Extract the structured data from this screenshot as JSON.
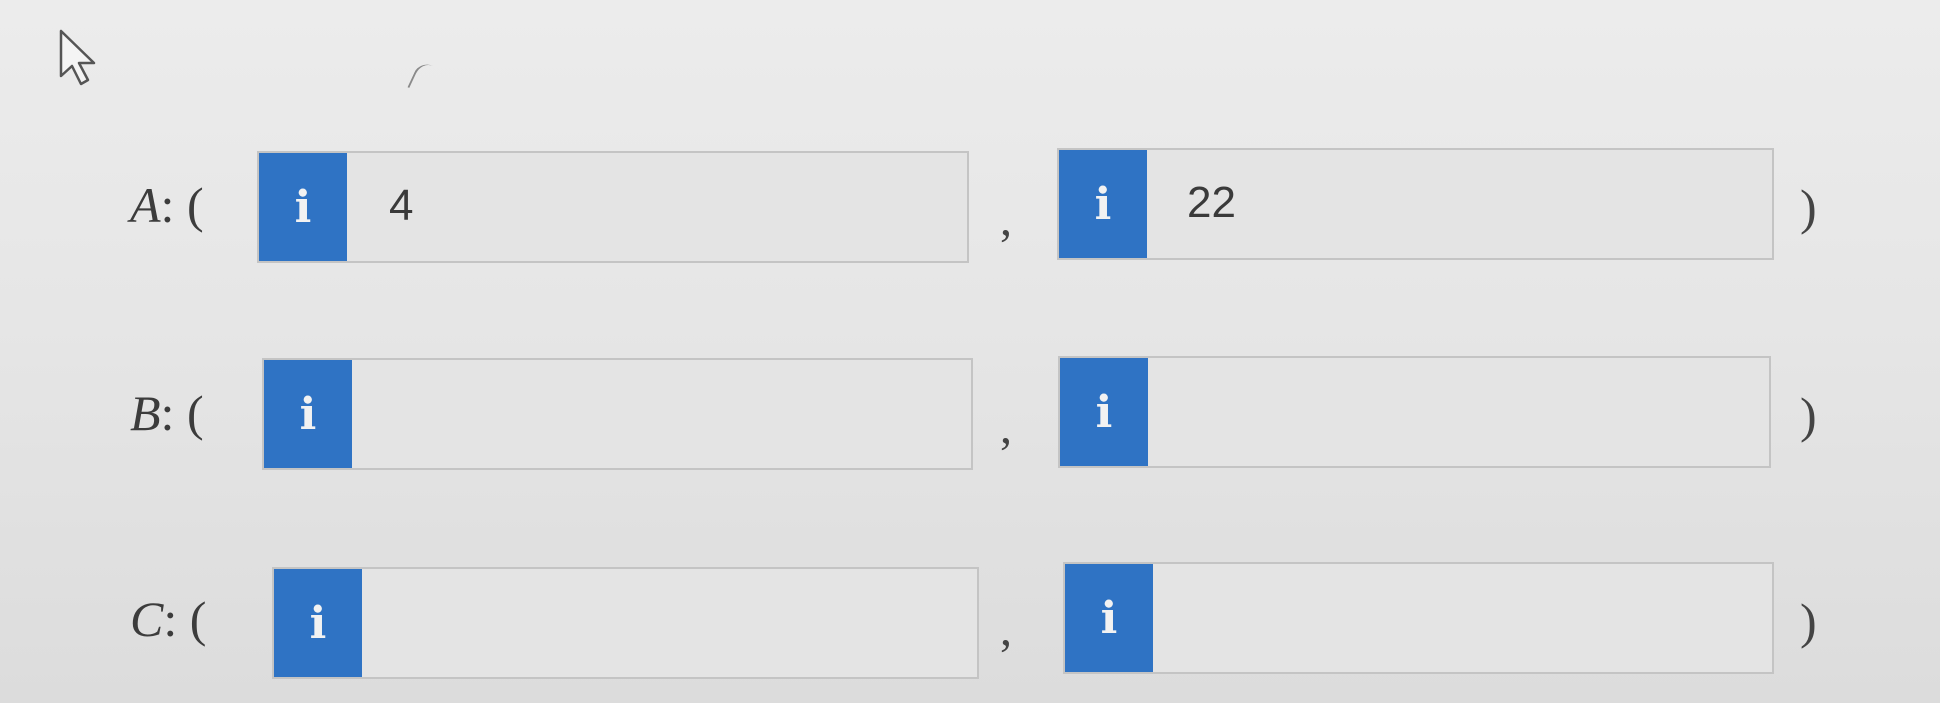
{
  "cursor": {
    "icon": "mouse-pointer-icon"
  },
  "accent_color": "#2f73c4",
  "info_icon_glyph": "i",
  "separators": {
    "comma": ",",
    "close_paren": ")"
  },
  "points": [
    {
      "label": "A",
      "open": ": (",
      "x_value": "4",
      "y_value": "22"
    },
    {
      "label": "B",
      "open": ": (",
      "x_value": "",
      "y_value": ""
    },
    {
      "label": "C",
      "open": ": (",
      "x_value": "",
      "y_value": ""
    }
  ]
}
